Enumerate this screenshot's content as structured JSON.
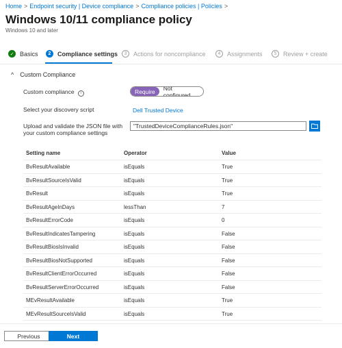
{
  "breadcrumb": [
    "Home",
    "Endpoint security | Device compliance",
    "Compliance policies | Policies"
  ],
  "breadcrumb_trailing": ">",
  "title": "Windows 10/11 compliance policy",
  "more_label": "···",
  "subtitle": "Windows 10 and later",
  "steps": [
    {
      "num": "✓",
      "label": "Basics",
      "state": "done"
    },
    {
      "num": "2",
      "label": "Compliance settings",
      "state": "active"
    },
    {
      "num": "3",
      "label": "Actions for noncompliance",
      "state": "pending"
    },
    {
      "num": "4",
      "label": "Assignments",
      "state": "pending"
    },
    {
      "num": "5",
      "label": "Review + create",
      "state": "pending"
    }
  ],
  "section": {
    "chevron": "^",
    "title": "Custom Compliance"
  },
  "custom_compliance": {
    "label": "Custom compliance",
    "info": "i",
    "options": [
      "Require",
      "Not configured"
    ],
    "selected": "Require"
  },
  "discovery": {
    "label": "Select your discovery script",
    "value": "Dell Trusted Device"
  },
  "upload": {
    "label": "Upload and validate the JSON file with your custom compliance settings",
    "value": "\"TrustedDeviceComplianceRules.json\""
  },
  "table": {
    "headers": [
      "Setting name",
      "Operator",
      "Value"
    ],
    "rows": [
      [
        "BvResultAvailable",
        "isEquals",
        "True"
      ],
      [
        "BvResultSourceIsValid",
        "isEquals",
        "True"
      ],
      [
        "BvResult",
        "isEquals",
        "True"
      ],
      [
        "BvResultAgeInDays",
        "lessThan",
        "7"
      ],
      [
        "BvResultErrorCode",
        "isEquals",
        "0"
      ],
      [
        "BvResultIndicatesTampering",
        "isEquals",
        "False"
      ],
      [
        "BvResultBiosIsInvalid",
        "isEquals",
        "False"
      ],
      [
        "BvResultBiosNotSupported",
        "isEquals",
        "False"
      ],
      [
        "BvResultClientErrorOccurred",
        "isEquals",
        "False"
      ],
      [
        "BvResultServerErrorOccurred",
        "isEquals",
        "False"
      ],
      [
        "MEvResultAvailable",
        "isEquals",
        "True"
      ],
      [
        "MEvResultSourceIsValid",
        "isEquals",
        "True"
      ]
    ]
  },
  "footer": {
    "previous": "Previous",
    "next": "Next"
  },
  "colors": {
    "accent": "#0078d4",
    "toggle_on": "#8764b8",
    "done": "#107c10"
  }
}
